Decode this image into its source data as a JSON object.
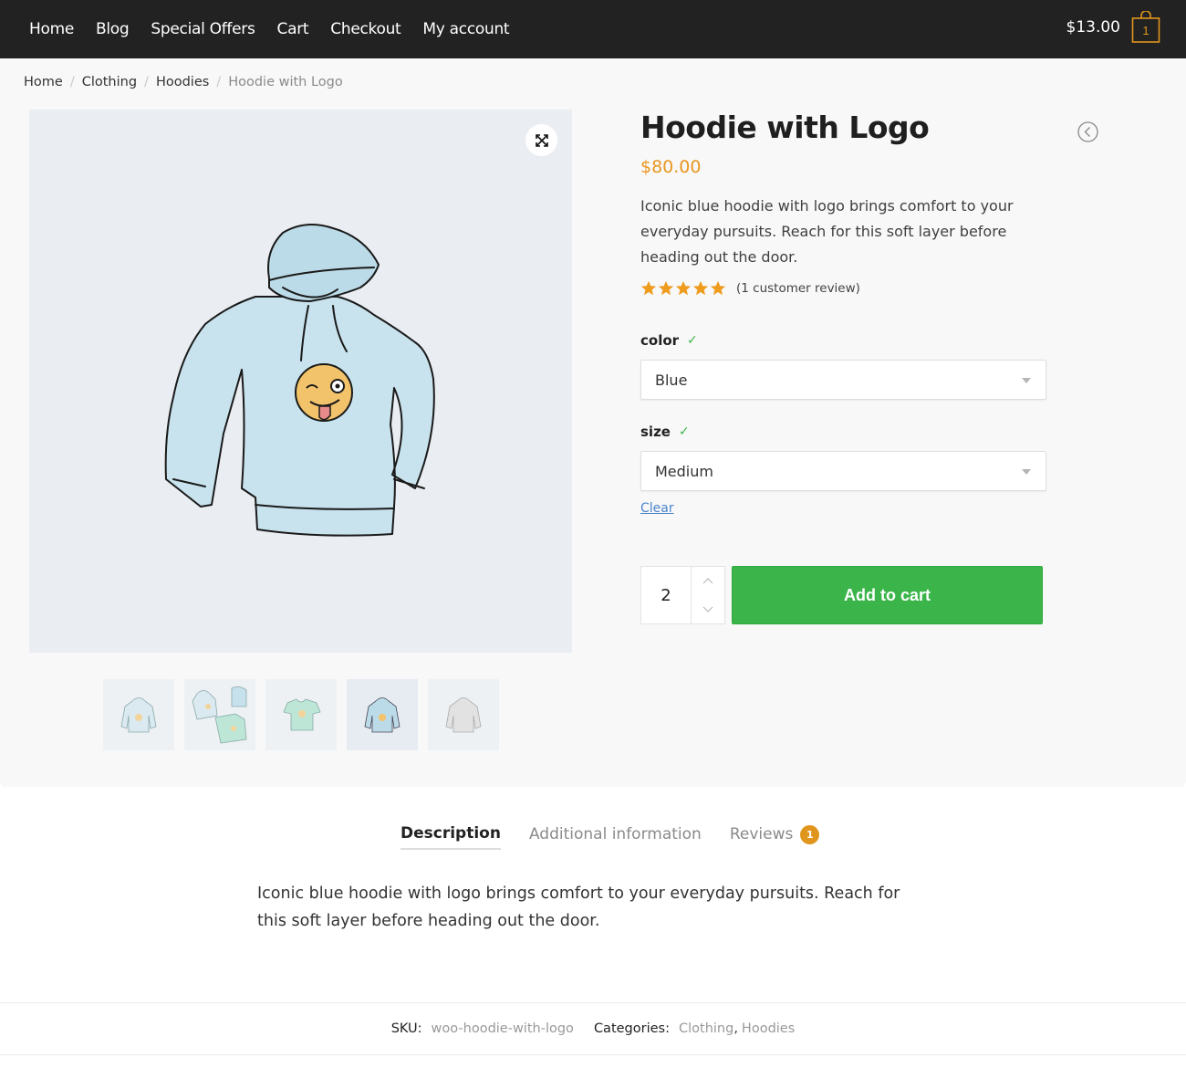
{
  "header": {
    "nav": [
      "Home",
      "Blog",
      "Special Offers",
      "Cart",
      "Checkout",
      "My account"
    ],
    "cart_total": "$13.00",
    "cart_count": "1",
    "accent": "#e0961d"
  },
  "breadcrumb": {
    "items": [
      "Home",
      "Clothing",
      "Hoodies"
    ],
    "current": "Hoodie with Logo",
    "separator": "/"
  },
  "gallery": {
    "main_image": "hoodie-with-logo-illustration",
    "zoom_icon": "expand-icon",
    "thumbnails": [
      "hoodie-blue-light",
      "hoodie-beanie-tshirt-set",
      "tshirt-green",
      "hoodie-blue",
      "hoodie-grey"
    ],
    "active_thumbnail": 3
  },
  "product": {
    "title": "Hoodie with Logo",
    "price": "$80.00",
    "price_color": "#e8961f",
    "short_description": "Iconic blue hoodie with logo brings comfort to your everyday pursuits. Reach for this soft layer before heading out the door.",
    "rating": 5,
    "rating_max": 5,
    "review_link": "(1 customer review)",
    "variations": [
      {
        "label": "color",
        "check": "✓",
        "selected": "Blue"
      },
      {
        "label": "size",
        "check": "✓",
        "selected": "Medium"
      }
    ],
    "clear_label": "Clear",
    "quantity": "2",
    "add_to_cart_label": "Add to cart",
    "button_color": "#3bb54a"
  },
  "tabs": {
    "items": [
      {
        "label": "Description",
        "active": true
      },
      {
        "label": "Additional information",
        "active": false
      },
      {
        "label": "Reviews",
        "badge": "1",
        "active": false
      }
    ]
  },
  "description": {
    "text": "Iconic blue hoodie with logo brings comfort to your everyday pursuits. Reach for this soft layer before heading out the door."
  },
  "meta": {
    "sku_label": "SKU:",
    "sku": "woo-hoodie-with-logo",
    "categories_label": "Categories:",
    "categories": [
      "Clothing",
      "Hoodies"
    ],
    "comma": ","
  }
}
